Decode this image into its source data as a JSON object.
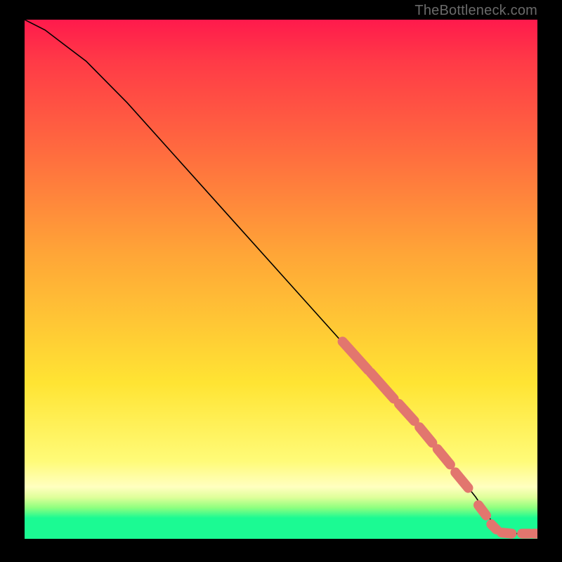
{
  "attribution": "TheBottleneck.com",
  "chart_data": {
    "type": "line",
    "title": "",
    "xlabel": "",
    "ylabel": "",
    "xlim": [
      0,
      100
    ],
    "ylim": [
      0,
      100
    ],
    "series": [
      {
        "name": "curve",
        "x": [
          0,
          4,
          8,
          12,
          20,
          30,
          40,
          50,
          60,
          70,
          78,
          84,
          88,
          90,
          92,
          95,
          98,
          100
        ],
        "y": [
          100,
          98,
          95,
          92,
          84,
          73,
          62,
          51,
          40,
          29,
          20,
          13,
          8,
          5,
          2,
          1,
          1,
          1
        ]
      }
    ],
    "markers": [
      {
        "name": "dash-segments",
        "color": "#e2766e",
        "segments": [
          {
            "x0": 62,
            "y0": 38,
            "x1": 67,
            "y1": 32.5
          },
          {
            "x0": 67.5,
            "y0": 32,
            "x1": 72,
            "y1": 27
          },
          {
            "x0": 73,
            "y0": 26,
            "x1": 76,
            "y1": 22.7
          },
          {
            "x0": 77,
            "y0": 21.5,
            "x1": 79.5,
            "y1": 18.5
          },
          {
            "x0": 80.5,
            "y0": 17.3,
            "x1": 83,
            "y1": 14.3
          },
          {
            "x0": 84,
            "y0": 12.8,
            "x1": 86.5,
            "y1": 9.8
          },
          {
            "x0": 88.5,
            "y0": 6.5,
            "x1": 90,
            "y1": 4.5
          },
          {
            "x0": 91,
            "y0": 2.8,
            "x1": 92,
            "y1": 1.8
          },
          {
            "x0": 93,
            "y0": 1.2,
            "x1": 95,
            "y1": 1
          },
          {
            "x0": 97,
            "y0": 1,
            "x1": 98.5,
            "y1": 1
          },
          {
            "x0": 99.2,
            "y0": 1,
            "x1": 100,
            "y1": 1
          }
        ]
      }
    ]
  }
}
